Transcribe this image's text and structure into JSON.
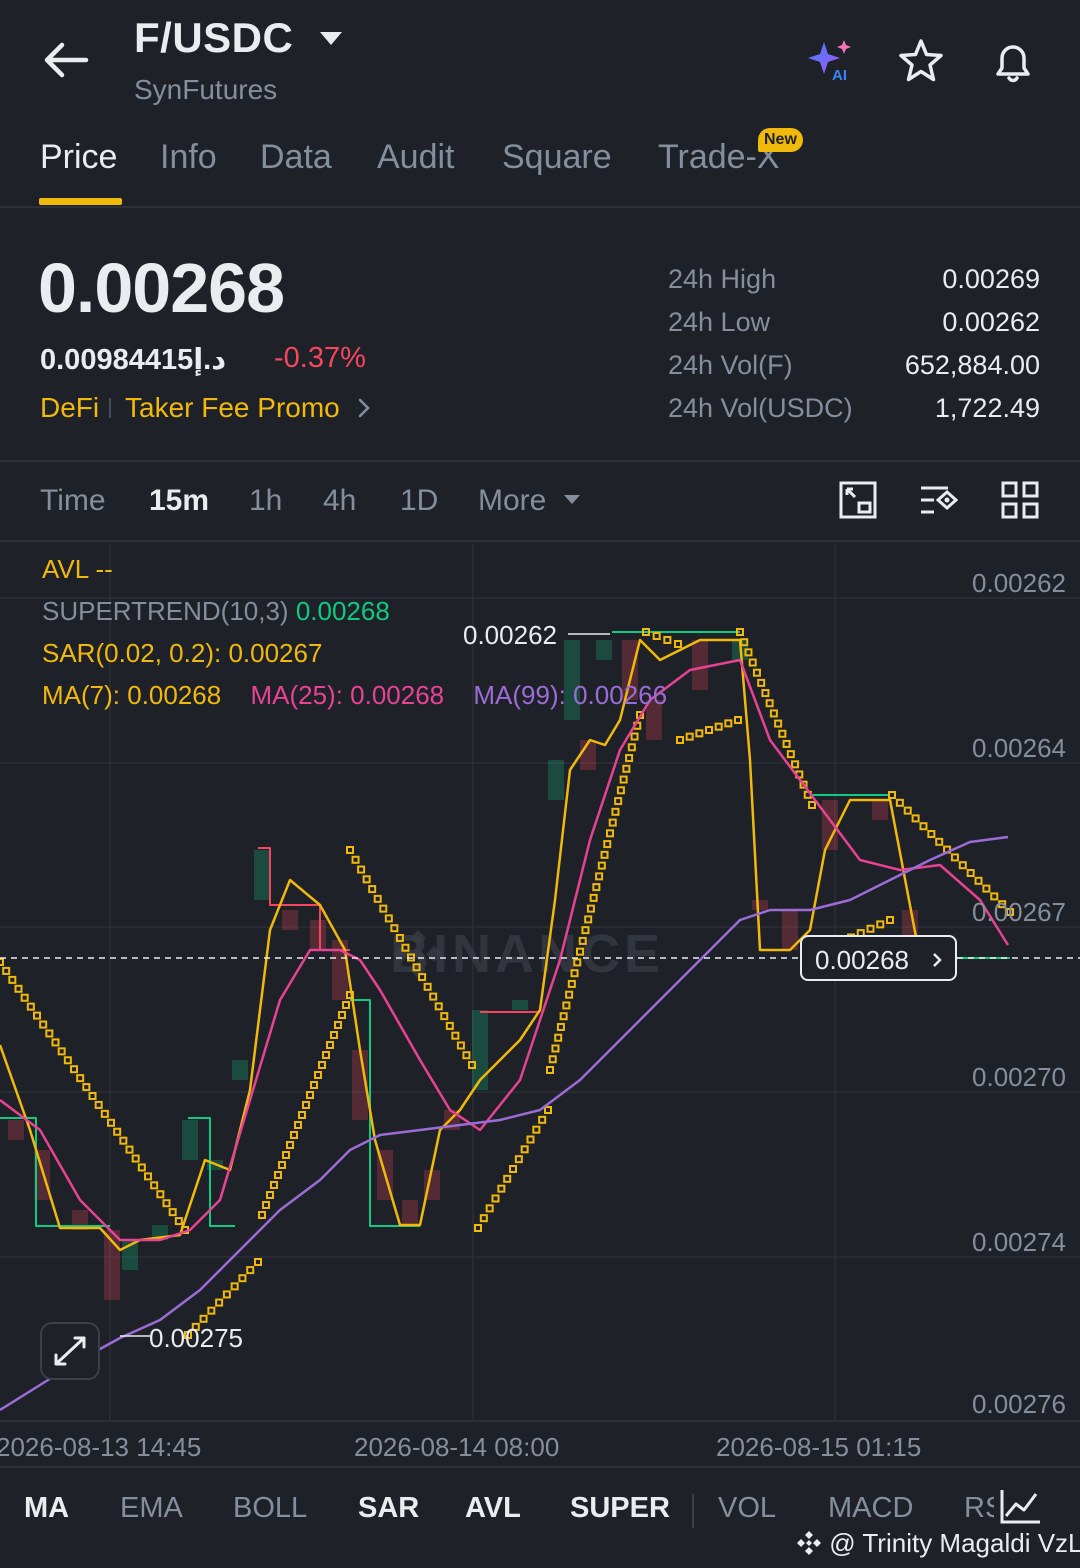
{
  "header": {
    "pair": "F/USDC",
    "exchange": "SynFutures",
    "icons": [
      "back-arrow-icon",
      "caret-down-icon",
      "ai-sparkle-icon",
      "star-icon",
      "bell-icon"
    ]
  },
  "tabs": [
    {
      "label": "Price",
      "active": true
    },
    {
      "label": "Info",
      "active": false
    },
    {
      "label": "Data",
      "active": false
    },
    {
      "label": "Audit",
      "active": false
    },
    {
      "label": "Square",
      "active": false
    },
    {
      "label": "Trade-X",
      "active": false,
      "badge": "New"
    }
  ],
  "ticker": {
    "last_price": "0.00268",
    "fiat_price": "0.00984415د.إ",
    "change_pct": "-0.37%",
    "tag_1": "DeFi",
    "tag_2": "Taker Fee Promo",
    "stats": [
      {
        "label": "24h High",
        "value": "0.00269"
      },
      {
        "label": "24h Low",
        "value": "0.00262"
      },
      {
        "label": "24h Vol(F)",
        "value": "652,884.00"
      },
      {
        "label": "24h Vol(USDC)",
        "value": "1,722.49"
      }
    ]
  },
  "timeframes": {
    "items": [
      {
        "label": "Time",
        "active": false
      },
      {
        "label": "15m",
        "active": true
      },
      {
        "label": "1h",
        "active": false
      },
      {
        "label": "4h",
        "active": false
      },
      {
        "label": "1D",
        "active": false
      },
      {
        "label": "More",
        "active": false
      }
    ],
    "tool_icons": [
      "fullscreen-chart-icon",
      "chart-settings-icon",
      "grid-layout-icon"
    ]
  },
  "chart": {
    "watermark": "BINANCE",
    "indicators": {
      "avl_label": "AVL",
      "avl_value": "--",
      "supertrend_label": "SUPERTREND(10,3)",
      "supertrend_value": "0.00268",
      "sar_label": "SAR(0.02, 0.2):",
      "sar_value": "0.00267",
      "ma7_label": "MA(7):",
      "ma7_value": "0.00268",
      "ma25_label": "MA(25):",
      "ma25_value": "0.00268",
      "ma99_label": "MA(99):",
      "ma99_value": "0.00266"
    },
    "y_axis": [
      "0.00262",
      "0.00264",
      "0.00267",
      "0.00270",
      "0.00274",
      "0.00276"
    ],
    "x_axis": [
      "2026-08-13 14:45",
      "2026-08-14 08:00",
      "2026-08-15 01:15"
    ],
    "high_marker": "0.00262",
    "low_marker": "0.00275",
    "current_price": "0.00268",
    "colors": {
      "up": "#0ecb81",
      "down": "#f6465d",
      "sar": "#f0b90b",
      "ma7": "#f0b90b",
      "ma25": "#e84393",
      "ma99": "#9b6cd6",
      "supertrend_label": "#0ecb81"
    }
  },
  "indicator_bar": [
    {
      "label": "MA",
      "active": true
    },
    {
      "label": "EMA",
      "active": false
    },
    {
      "label": "BOLL",
      "active": false
    },
    {
      "label": "SAR",
      "active": true
    },
    {
      "label": "AVL",
      "active": true
    },
    {
      "label": "SUPER",
      "active": true
    },
    {
      "label": "VOL",
      "active": false
    },
    {
      "label": "MACD",
      "active": false
    },
    {
      "label": "RSI",
      "active": false
    }
  ],
  "credit": "@ Trinity Magaldi VzLr"
}
